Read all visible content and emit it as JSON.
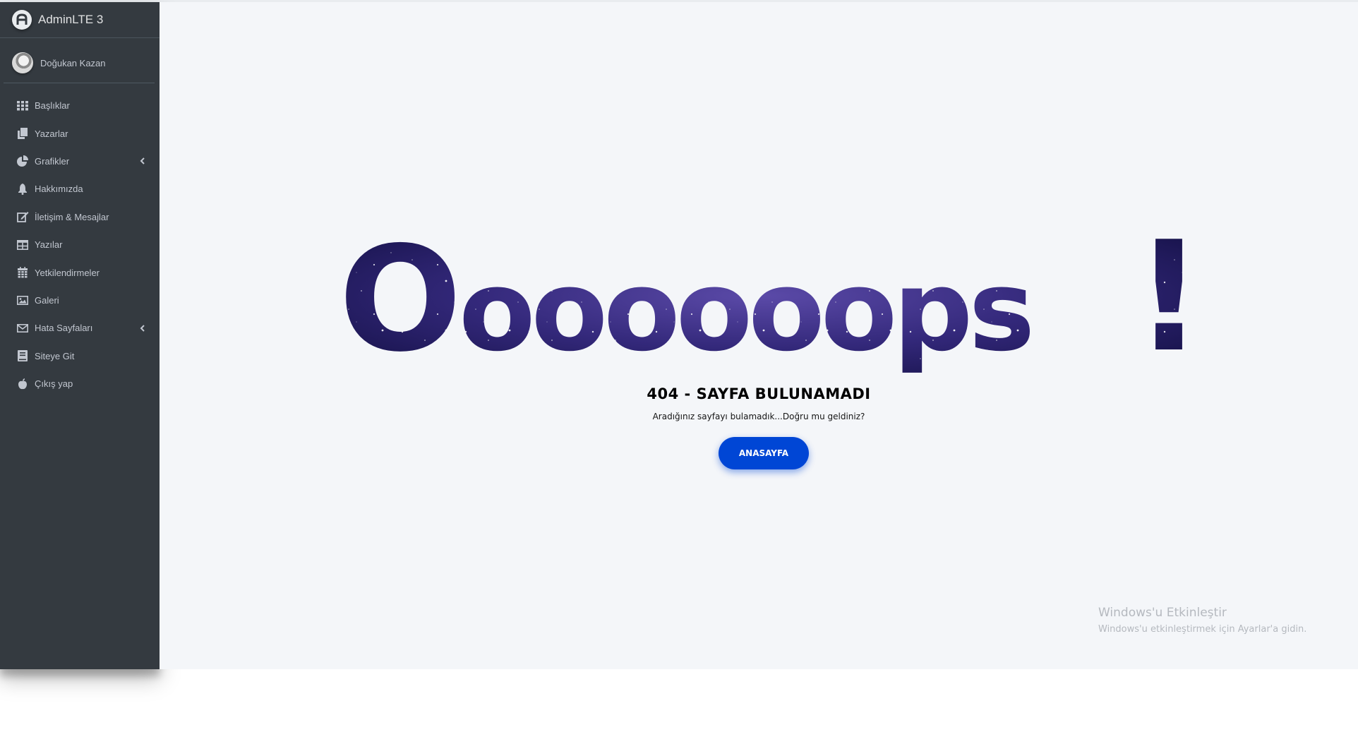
{
  "brand": {
    "name": "AdminLTE 3"
  },
  "user": {
    "name": "Doğukan Kazan"
  },
  "sidebar": {
    "items": [
      {
        "label": "Başlıklar",
        "icon": "grid-icon",
        "has_caret": false
      },
      {
        "label": "Yazarlar",
        "icon": "copy-icon",
        "has_caret": false
      },
      {
        "label": "Grafikler",
        "icon": "pie-chart-icon",
        "has_caret": true
      },
      {
        "label": "Hakkımızda",
        "icon": "bell-icon",
        "has_caret": false
      },
      {
        "label": "İletişim & Mesajlar",
        "icon": "edit-icon",
        "has_caret": false
      },
      {
        "label": "Yazılar",
        "icon": "table-icon",
        "has_caret": false
      },
      {
        "label": "Yetkilendirmeler",
        "icon": "calendar-icon",
        "has_caret": false
      },
      {
        "label": "Galeri",
        "icon": "image-icon",
        "has_caret": false
      },
      {
        "label": "Hata Sayfaları",
        "icon": "envelope-icon",
        "has_caret": true
      },
      {
        "label": "Siteye Git",
        "icon": "book-icon",
        "has_caret": false
      },
      {
        "label": "Çıkış yap",
        "icon": "apple-icon",
        "has_caret": false
      }
    ]
  },
  "error": {
    "big_text": "Oooooops!",
    "title": "404 - SAYFA BULUNAMADI",
    "message": "Aradığınız sayfayı bulamadık...Doğru mu geldiniz?",
    "button_label": "ANASAYFA"
  },
  "watermark": {
    "title": "Windows'u Etkinleştir",
    "subtitle": "Windows'u etkinleştirmek için Ayarlar'a gidin."
  },
  "colors": {
    "sidebar_bg": "#343a40",
    "content_bg": "#f4f6f9",
    "button_bg": "#0046d5",
    "galaxy_dark": "#0d0b3a",
    "galaxy_purple": "#4a3a9a"
  }
}
